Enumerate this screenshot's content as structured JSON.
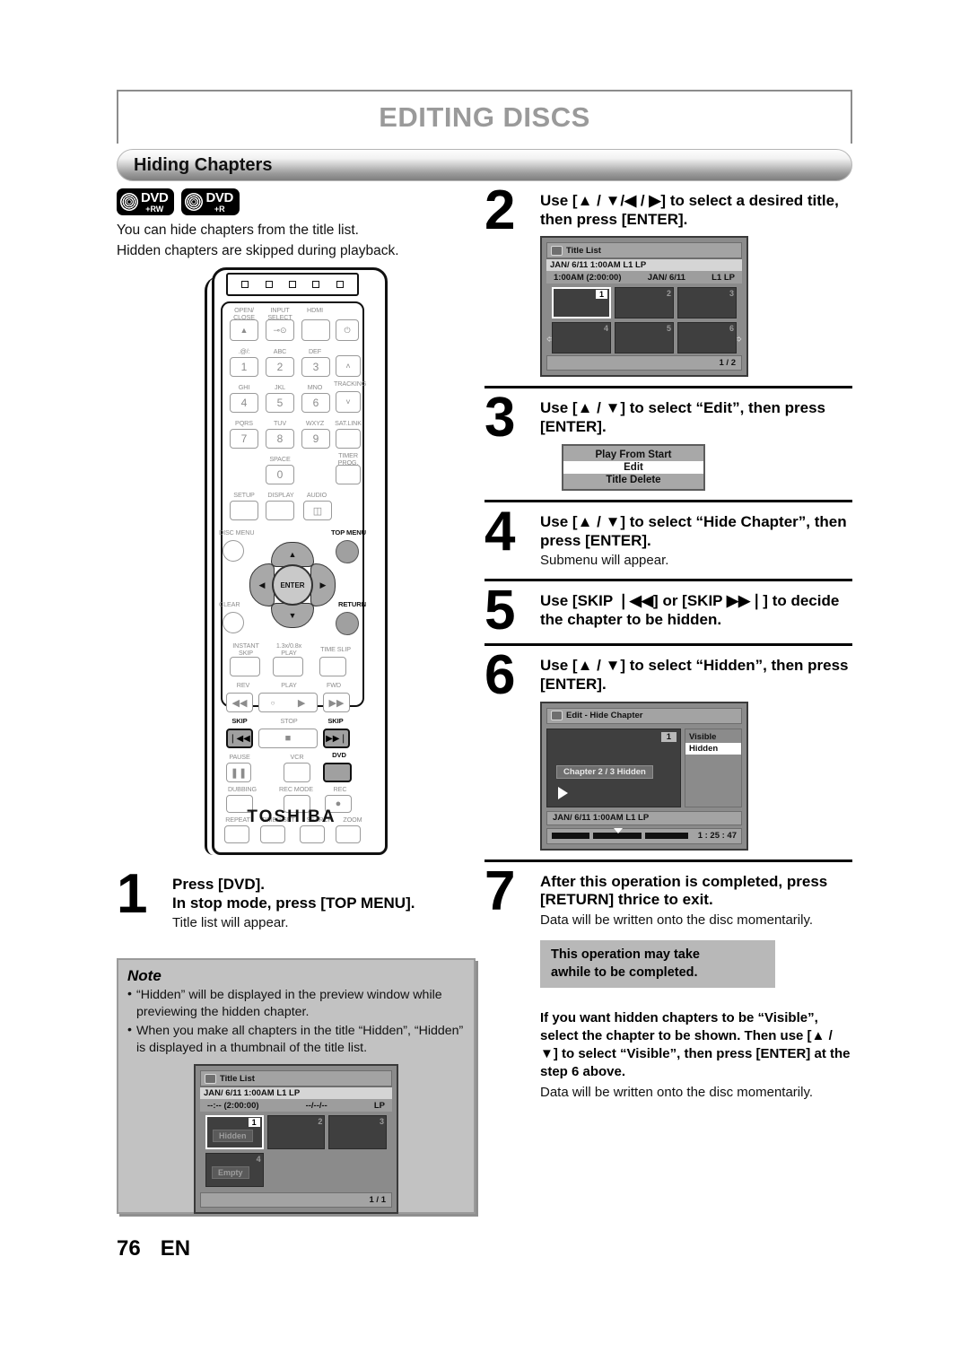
{
  "header": {
    "title": "EDITING DISCS",
    "section": "Hiding Chapters"
  },
  "badges": [
    {
      "name": "dvd-plus-rw-badge",
      "main": "DVD",
      "sub": "+RW"
    },
    {
      "name": "dvd-plus-r-badge",
      "main": "DVD",
      "sub": "+R"
    }
  ],
  "intro": [
    "You can hide chapters from the title list.",
    "Hidden chapters are skipped during playback."
  ],
  "remote": {
    "brand": "TOSHIBA",
    "labels": {
      "open_close": "OPEN/\nCLOSE",
      "input_select": "INPUT\nSELECT",
      "hdmi": "HDMI",
      "power": "I/⏻",
      "key1_alpha": ".@/:",
      "key2_alpha": "ABC",
      "key3_alpha": "DEF",
      "key4_alpha": "GHI",
      "key5_alpha": "JKL",
      "key6_alpha": "MNO",
      "key7_alpha": "PQRS",
      "key8_alpha": "TUV",
      "key9_alpha": "WXYZ",
      "key0_alpha": "SPACE",
      "tracking": "TRACKING",
      "sat_link": "SAT.LINK",
      "timer_prog": "TIMER\nPROG.",
      "setup": "SETUP",
      "display": "DISPLAY",
      "audio": "AUDIO",
      "disc_menu": "DISC MENU",
      "top_menu": "TOP MENU",
      "clear": "CLEAR",
      "return": "RETURN",
      "enter": "ENTER",
      "instant_skip": "INSTANT\nSKIP",
      "speed_play": "1.3x/0.8x\nPLAY",
      "time_slip": "TIME SLIP",
      "rev": "REV",
      "play": "PLAY",
      "fwd": "FWD",
      "skip_back": "SKIP",
      "stop": "STOP",
      "skip_fwd": "SKIP",
      "pause": "PAUSE",
      "vcr": "VCR",
      "dvd": "DVD",
      "dubbing": "DUBBING",
      "rec_mode": "REC MODE",
      "rec": "REC",
      "repeat": "REPEAT",
      "timer_set": "TIMER SET",
      "search": "SEARCH",
      "zoom": "ZOOM"
    },
    "keys": [
      "1",
      "2",
      "3",
      "4",
      "5",
      "6",
      "7",
      "8",
      "9",
      "0"
    ]
  },
  "steps": {
    "s1": {
      "num": "1",
      "title_line1": "Press [DVD].",
      "title_line2": "In stop mode, press [TOP MENU].",
      "sub": "Title list will appear."
    },
    "s2": {
      "num": "2",
      "title": "Use [▲ / ▼/◀ / ▶] to select a desired title, then press [ENTER].",
      "screen": {
        "title": "Title List",
        "row_a": "JAN/ 6/11 1:00AM   L1   LP",
        "row_b_left": "1:00AM (2:00:00)",
        "row_b_mid": "JAN/ 6/11",
        "row_b_right": "L1   LP",
        "thumbs": [
          {
            "n": "1",
            "selected": true
          },
          {
            "n": "2",
            "selected": false
          },
          {
            "n": "3",
            "selected": false
          },
          {
            "n": "4",
            "selected": false
          },
          {
            "n": "5",
            "selected": false
          },
          {
            "n": "6",
            "selected": false
          }
        ],
        "page": "1 / 2",
        "arrow_left": "⇦",
        "arrow_right": "⇨"
      }
    },
    "s3": {
      "num": "3",
      "title": "Use [▲ / ▼] to select “Edit”, then press [ENTER].",
      "menu": [
        {
          "label": "Play From Start",
          "selected": false
        },
        {
          "label": "Edit",
          "selected": true
        },
        {
          "label": "Title Delete",
          "selected": false
        }
      ]
    },
    "s4": {
      "num": "4",
      "title": "Use [▲ / ▼] to select “Hide Chapter”, then press [ENTER].",
      "sub": "Submenu will appear."
    },
    "s5": {
      "num": "5",
      "title": "Use [SKIP ❘◀◀] or [SKIP ▶▶❘] to decide the chapter to be hidden."
    },
    "s6": {
      "num": "6",
      "title": "Use [▲ / ▼] to select “Hidden”, then press [ENTER].",
      "screen": {
        "title": "Edit - Hide Chapter",
        "preview_num": "1",
        "chip": "Chapter   2 / 3   Hidden",
        "options": [
          {
            "label": "Visible",
            "selected": false
          },
          {
            "label": "Hidden",
            "selected": true
          }
        ],
        "info": "JAN/ 6/11 1:00AM L1   LP",
        "time": "1 : 25 : 47"
      }
    },
    "s7": {
      "num": "7",
      "title": "After this operation is completed, press [RETURN] thrice to exit.",
      "sub": "Data will be written onto the disc momentarily.",
      "callout_line1": "This operation may take",
      "callout_line2": "awhile to be completed.",
      "after_bold": "If you want hidden chapters to be “Visible”, select the chapter to be shown. Then use [▲ / ▼] to select “Visible”, then press [ENTER] at the step 6 above.",
      "after_normal": "Data will be written onto the disc momentarily."
    }
  },
  "note": {
    "title": "Note",
    "items": [
      "“Hidden” will be displayed in the preview window while previewing the hidden chapter.",
      "When you make all chapters in the title “Hidden”, “Hidden” is displayed in a thumbnail of the title list."
    ],
    "bullet": "•",
    "screen": {
      "title": "Title List",
      "row_a": "JAN/ 6/11 1:00AM  L1  LP",
      "row_b_left": "--:-- (2:00:00)",
      "row_b_mid": "--/--/--",
      "row_b_right": "LP",
      "thumbs": [
        {
          "n": "1",
          "selected": true,
          "tag": "Hidden"
        },
        {
          "n": "2",
          "selected": false,
          "tag": ""
        },
        {
          "n": "3",
          "selected": false,
          "tag": ""
        },
        {
          "n": "4",
          "selected": false,
          "tag": "Empty"
        }
      ],
      "page": "1 / 1"
    }
  },
  "footer": {
    "page": "76",
    "lang": "EN"
  }
}
